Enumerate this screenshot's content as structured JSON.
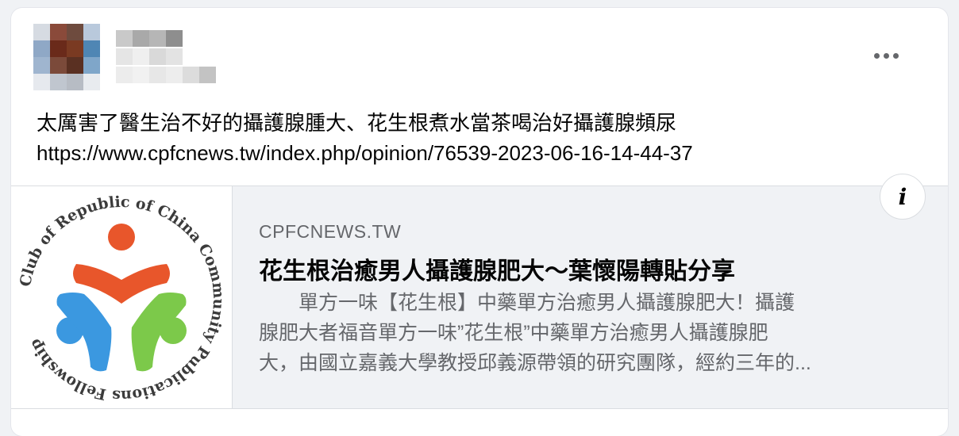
{
  "post": {
    "text_line1": "太厲害了醫生治不好的攝護腺腫大、花生根煮水當茶喝治好攝護腺頻尿",
    "text_line2": "https://www.cpfcnews.tw/index.php/opinion/76539-2023-06-16-14-44-37"
  },
  "header": {
    "more_icon": "more-horizontal-icon"
  },
  "link_preview": {
    "domain": "CPFCNEWS.TW",
    "title": "花生根治癒男人攝護腺肥大～葉懷陽轉貼分享",
    "desc_line1": "　　單方一味【花生根】中藥單方治癒男人攝護腺肥大！攝護",
    "desc_line2": "腺肥大者福音單方一味”花生根”中藥單方治癒男人攝護腺肥",
    "desc_line3": "大，由國立嘉義大學教授邱義源帶領的研究團隊，經約三年的...",
    "info_label": "i",
    "logo_ring_text": "Club of Republic of China Community Publications Fellowship",
    "logo_colors": {
      "orange": "#e8562b",
      "blue": "#3b98e0",
      "green": "#7cc94a"
    }
  },
  "colors": {
    "primary_text": "#050505",
    "secondary_text": "#65676b",
    "card_bg": "#ffffff",
    "page_bg": "#f0f2f5"
  }
}
